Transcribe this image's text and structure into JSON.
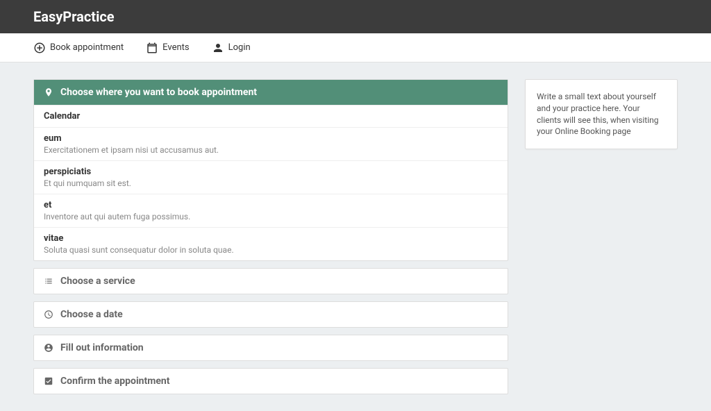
{
  "header": {
    "title": "EasyPractice"
  },
  "nav": {
    "book": "Book appointment",
    "events": "Events",
    "login": "Login"
  },
  "steps": {
    "where": "Choose where you want to book appointment",
    "service": "Choose a service",
    "date": "Choose a date",
    "info": "Fill out information",
    "confirm": "Confirm the appointment"
  },
  "calendar_label": "Calendar",
  "calendars": [
    {
      "name": "eum",
      "desc": "Exercitationem et ipsam nisi ut accusamus aut."
    },
    {
      "name": "perspiciatis",
      "desc": "Et qui numquam sit est."
    },
    {
      "name": "et",
      "desc": "Inventore aut qui autem fuga possimus."
    },
    {
      "name": "vitae",
      "desc": "Soluta quasi sunt consequatur dolor in soluta quae."
    }
  ],
  "sidebar": {
    "about": "Write a small text about yourself and your practice here. Your clients will see this, when visiting your Online Booking page"
  }
}
